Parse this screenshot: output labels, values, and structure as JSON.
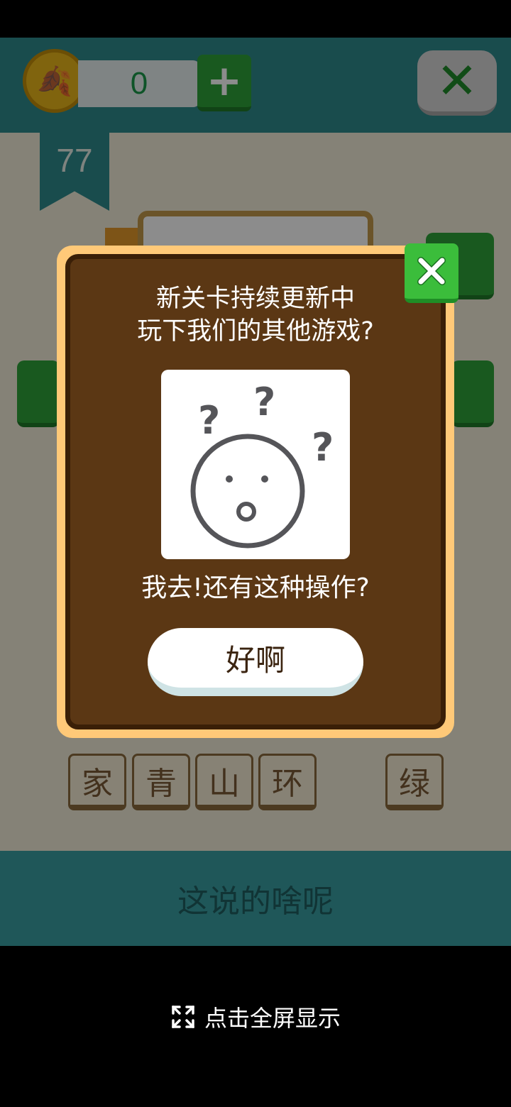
{
  "game": {
    "coins": "0",
    "level": "77",
    "answer_chars": [
      "家",
      "青",
      "山",
      "环",
      "绿"
    ],
    "banner_text": "这说的啥呢"
  },
  "dialog": {
    "line1": "新关卡持续更新中",
    "line2": "玩下我们的其他游戏?",
    "caption": "我去!还有这种操作?",
    "ok_label": "好啊"
  },
  "fullscreen": {
    "label": "点击全屏显示"
  },
  "colors": {
    "dialog_border": "#ffc978",
    "dialog_bg": "#5b3714",
    "close_green": "#3bbd3b",
    "teal": "#2f8a8c"
  }
}
